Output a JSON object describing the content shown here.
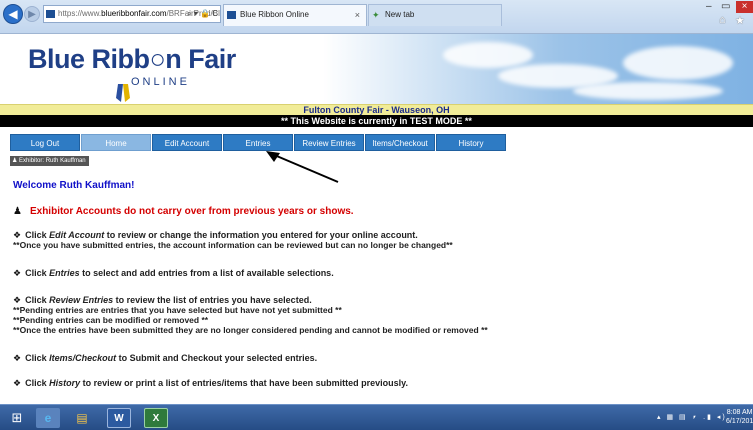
{
  "browser": {
    "url_prefix": "https://www.",
    "url_domain": "blueribbonfair.com",
    "url_rest": "/BRFairProd/BlueR",
    "url_controls": "⌕ ▾ 🔒 C",
    "active_tab": "Blue Ribbon Online",
    "inactive_tab": "New tab",
    "tab_close": "×",
    "icons": [
      "back-arrow-icon",
      "forward-arrow-icon",
      "home-icon",
      "star-icon",
      "minimize-icon",
      "close-icon"
    ]
  },
  "banner": {
    "logo_text": "Blue Ribb○n Fair",
    "logo_sub": "ONLINE"
  },
  "fair": {
    "title": "Fulton County Fair - Wauseon, OH",
    "test_mode": "** This Website is currently in TEST MODE **"
  },
  "menu": {
    "items": [
      "Log Out",
      "Home",
      "Edit Account",
      "Entries",
      "Review Entries",
      "Items/Checkout",
      "History"
    ],
    "current": "Home"
  },
  "exhibitor": {
    "label": "Exhibitor: Ruth Kauffman"
  },
  "content": {
    "welcome": "Welcome Ruth Kauffman!",
    "warning": "Exhibitor Accounts do not carry over from previous years or shows.",
    "edit": {
      "pre": "Click ",
      "link": "Edit Account",
      "post": " to review or change the information you entered for your online account.",
      "note": "**Once you have submitted entries, the account information can be reviewed but can no longer be changed**"
    },
    "entries": {
      "pre": "Click ",
      "link": "Entries",
      "post": " to select and add entries from a list of available selections."
    },
    "review": {
      "pre": "Click ",
      "link": "Review Entries",
      "post": " to review the list of entries you have selected.",
      "note1": "**Pending entries are entries that you have selected but have not yet submitted **",
      "note2": "**Pending entries can be modified or removed **",
      "note3": "**Once the entries have been submitted they are no longer considered pending and cannot be modified or removed **"
    },
    "checkout": {
      "pre": "Click ",
      "link": "Items/Checkout",
      "post": " to Submit and Checkout your selected entries."
    },
    "history": {
      "pre": "Click ",
      "link": "History",
      "post": " to review or print a list of entries/items that have been submitted previously."
    }
  },
  "taskbar": {
    "time": "8:08 AM",
    "date": "6/17/201",
    "tray": "▴ ▦ ▤ ⎖ .▮ ◂)"
  },
  "colors": {
    "menu_blue": "#2e7bc4",
    "menu_current": "#8ab7e2",
    "fair_bar": "#f1ec98",
    "welcome_text": "#1010c8",
    "warning_text": "#d40000"
  }
}
